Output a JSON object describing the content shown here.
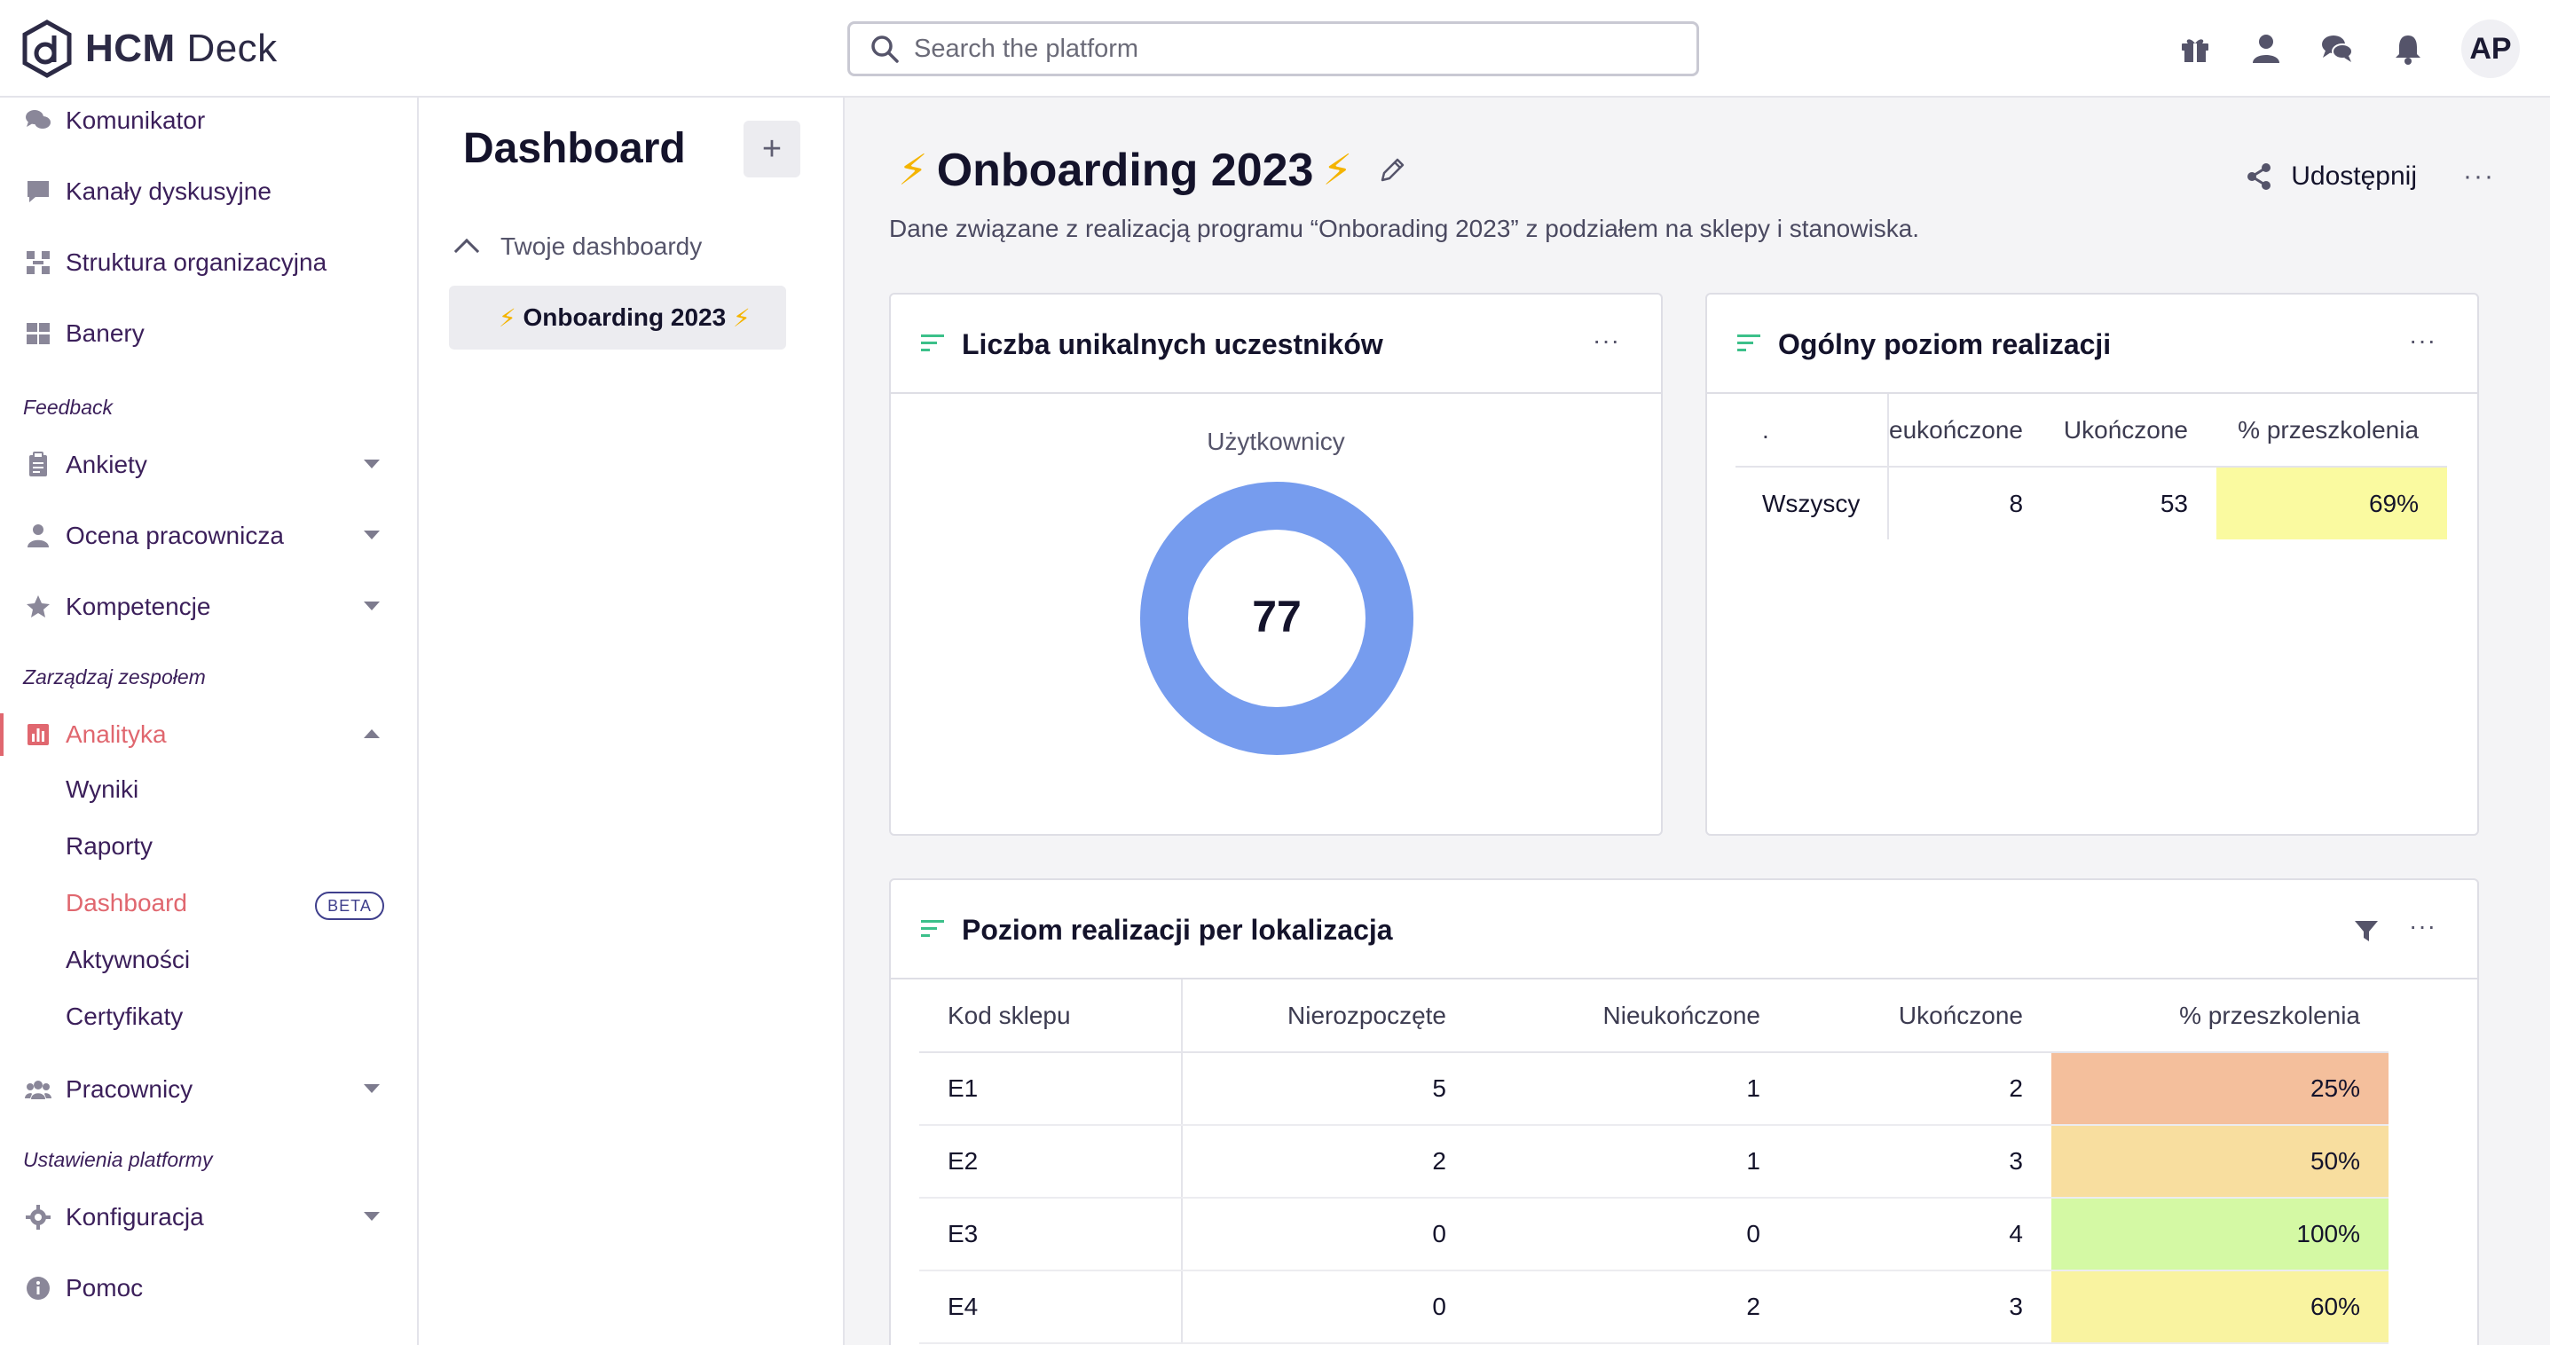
{
  "app": {
    "logo_bold": "HCM",
    "logo_light": "Deck"
  },
  "search": {
    "placeholder": "Search the platform"
  },
  "user": {
    "initials": "AP"
  },
  "sidebar": {
    "items": [
      {
        "label": "Komunikator"
      },
      {
        "label": "Kanały dyskusyjne"
      },
      {
        "label": "Struktura organizacyjna"
      },
      {
        "label": "Banery"
      },
      {
        "label": "Ankiety"
      },
      {
        "label": "Ocena pracownicza"
      },
      {
        "label": "Kompetencje"
      },
      {
        "label": "Analityka"
      },
      {
        "label": "Pracownicy"
      },
      {
        "label": "Konfiguracja"
      },
      {
        "label": "Pomoc"
      }
    ],
    "sections": [
      "Feedback",
      "Zarządzaj zespołem",
      "Ustawienia platformy"
    ],
    "analytics_sub": [
      "Wyniki",
      "Raporty",
      "Dashboard",
      "Aktywności",
      "Certyfikaty"
    ],
    "beta_label": "BETA"
  },
  "dashboards": {
    "title": "Dashboard",
    "add_label": "+",
    "group_label": "Twoje dashboardy",
    "active_dashboard": "Onboarding 2023"
  },
  "page": {
    "title": "Onboarding 2023",
    "bolt": "⚡",
    "description": "Dane związane z realizacją programu “Onborading 2023” z podziałem na sklepy i stanowiska.",
    "share_label": "Udostępnij",
    "more": "···"
  },
  "card_participants": {
    "title": "Liczba unikalnych uczestników",
    "more": "···",
    "chart_label": "Użytkownicy",
    "value": "77",
    "color": "#769cee"
  },
  "card_overall": {
    "title": "Ogólny poziom realizacji",
    "more": "···",
    "headers": [
      ".",
      "eukończone",
      "Ukończone",
      "% przeszkolenia"
    ],
    "row": {
      "label": "Wszyscy",
      "nieukonczone": "8",
      "ukonczone": "53",
      "percent": "69%",
      "percent_color": "#fafaa0"
    }
  },
  "card_location": {
    "title": "Poziom realizacji per lokalizacja",
    "more": "···",
    "headers": [
      "Kod sklepu",
      "Nierozpoczęte",
      "Nieukończone",
      "Ukończone",
      "% przeszkolenia"
    ],
    "rows": [
      {
        "code": "E1",
        "nierozpoczete": "5",
        "nieukonczone": "1",
        "ukonczone": "2",
        "percent": "25%",
        "color": "#f4bf9c"
      },
      {
        "code": "E2",
        "nierozpoczete": "2",
        "nieukonczone": "1",
        "ukonczone": "3",
        "percent": "50%",
        "color": "#f8de9f"
      },
      {
        "code": "E3",
        "nierozpoczete": "0",
        "nieukonczone": "0",
        "ukonczone": "4",
        "percent": "100%",
        "color": "#d4f9a4"
      },
      {
        "code": "E4",
        "nierozpoczete": "0",
        "nieukonczone": "2",
        "ukonczone": "3",
        "percent": "60%",
        "color": "#f9f3a0"
      }
    ]
  }
}
